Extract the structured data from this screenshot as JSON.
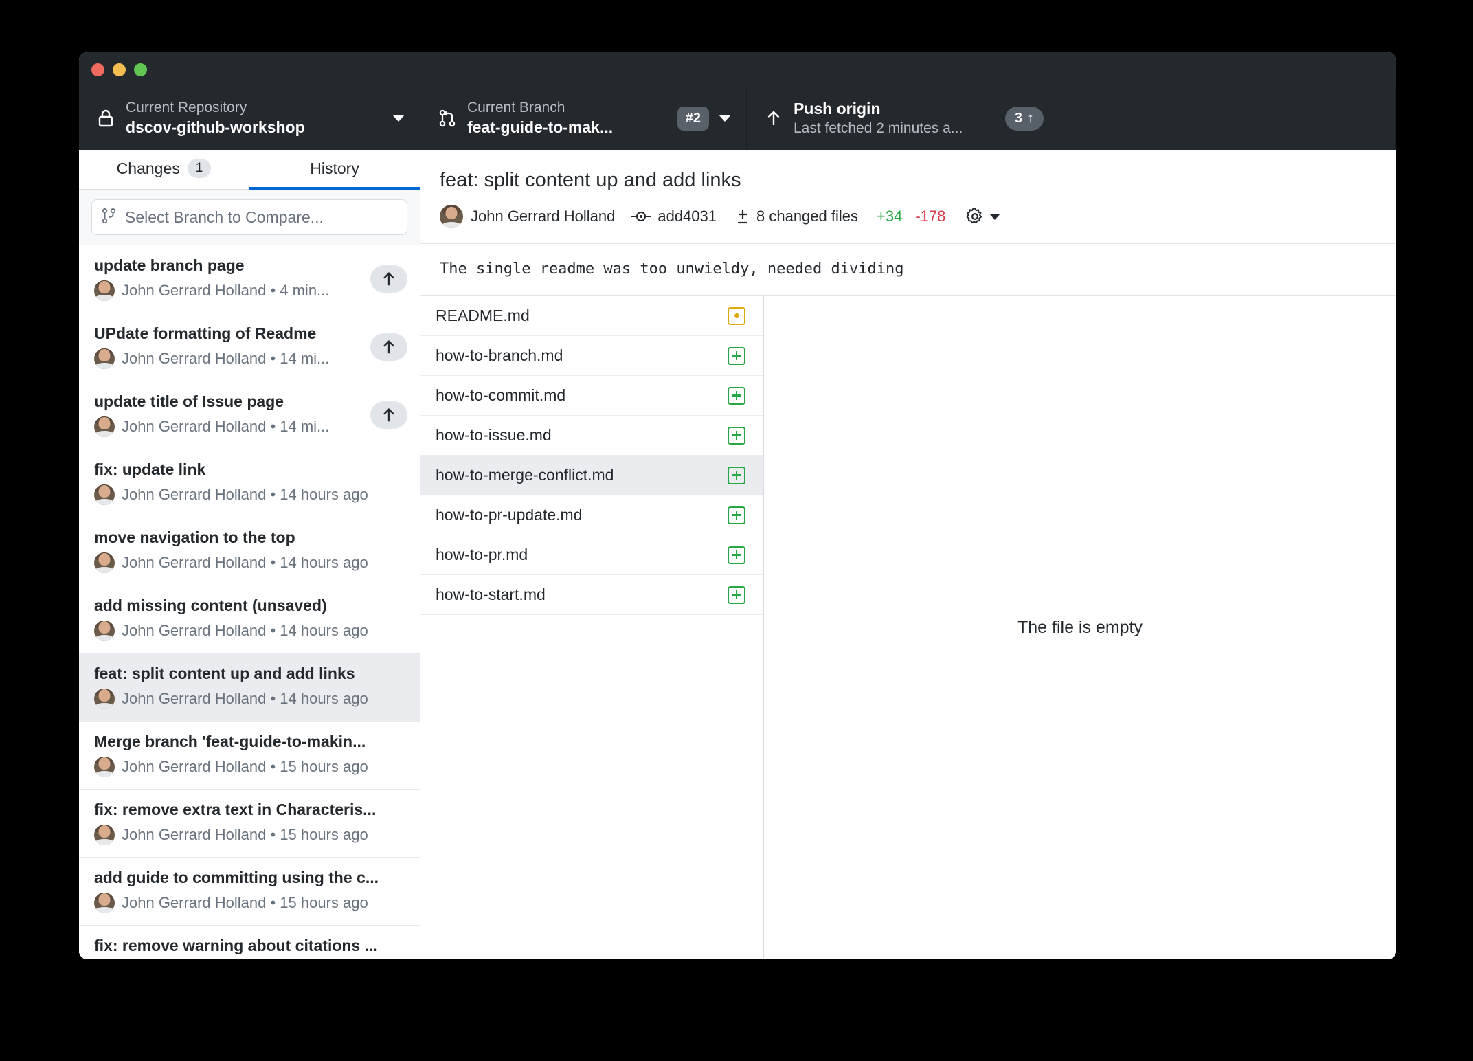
{
  "window": {
    "traffic_lights": [
      "close",
      "minimize",
      "maximize"
    ]
  },
  "toolbar": {
    "repository": {
      "label": "Current Repository",
      "value": "dscov-github-workshop",
      "icon": "lock-icon"
    },
    "branch": {
      "label": "Current Branch",
      "value": "feat-guide-to-mak...",
      "badge": "#2",
      "icon": "branch-icon"
    },
    "push": {
      "label": "Push origin",
      "sub": "Last fetched 2 minutes a...",
      "badge_count": "3",
      "badge_arrow": "↑",
      "icon": "arrow-up-icon"
    }
  },
  "sidebar": {
    "tabs": [
      {
        "label": "Changes",
        "count": "1",
        "active": false
      },
      {
        "label": "History",
        "count": "",
        "active": true
      }
    ],
    "compare": {
      "placeholder": "Select Branch to Compare...",
      "icon": "branch-compare-icon"
    },
    "commits": [
      {
        "title": "update branch page",
        "author": "John Gerrard Holland",
        "time": "4 min...",
        "unpushed": true,
        "selected": false
      },
      {
        "title": "UPdate formatting of Readme",
        "author": "John Gerrard Holland",
        "time": "14 mi...",
        "unpushed": true,
        "selected": false
      },
      {
        "title": "update title of Issue page",
        "author": "John Gerrard Holland",
        "time": "14 mi...",
        "unpushed": true,
        "selected": false
      },
      {
        "title": "fix: update link",
        "author": "John Gerrard Holland",
        "time": "14 hours ago",
        "unpushed": false,
        "selected": false
      },
      {
        "title": "move navigation to the top",
        "author": "John Gerrard Holland",
        "time": "14 hours ago",
        "unpushed": false,
        "selected": false
      },
      {
        "title": "add missing content (unsaved)",
        "author": "John Gerrard Holland",
        "time": "14 hours ago",
        "unpushed": false,
        "selected": false
      },
      {
        "title": "feat: split content up and add links",
        "author": "John Gerrard Holland",
        "time": "14 hours ago",
        "unpushed": false,
        "selected": true
      },
      {
        "title": "Merge branch 'feat-guide-to-makin...",
        "author": "John Gerrard Holland",
        "time": "15 hours ago",
        "unpushed": false,
        "selected": false
      },
      {
        "title": "fix: remove extra text in Characteris...",
        "author": "John Gerrard Holland",
        "time": "15 hours ago",
        "unpushed": false,
        "selected": false
      },
      {
        "title": "add guide to committing using the c...",
        "author": "John Gerrard Holland",
        "time": "15 hours ago",
        "unpushed": false,
        "selected": false
      },
      {
        "title": "fix: remove warning about citations ...",
        "author": "John Gerrard Holland",
        "time": "",
        "unpushed": false,
        "selected": false
      }
    ]
  },
  "commit_detail": {
    "summary": "feat: split content up and add links",
    "author": "John Gerrard Holland",
    "sha": "add4031",
    "changed_files": "8 changed files",
    "added": "+34",
    "removed": "-178",
    "description": "The single readme was too unwieldy, needed dividing",
    "files": [
      {
        "name": "README.md",
        "status": "modified",
        "selected": false
      },
      {
        "name": "how-to-branch.md",
        "status": "added",
        "selected": false
      },
      {
        "name": "how-to-commit.md",
        "status": "added",
        "selected": false
      },
      {
        "name": "how-to-issue.md",
        "status": "added",
        "selected": false
      },
      {
        "name": "how-to-merge-conflict.md",
        "status": "added",
        "selected": true
      },
      {
        "name": "how-to-pr-update.md",
        "status": "added",
        "selected": false
      },
      {
        "name": "how-to-pr.md",
        "status": "added",
        "selected": false
      },
      {
        "name": "how-to-start.md",
        "status": "added",
        "selected": false
      }
    ],
    "diff_empty_message": "The file is empty"
  },
  "colors": {
    "toolbar_bg": "#24292e",
    "accent": "#0366d6",
    "added_green": "#28a745",
    "removed_red": "#d73a49",
    "modified_yellow": "#dbab09"
  }
}
